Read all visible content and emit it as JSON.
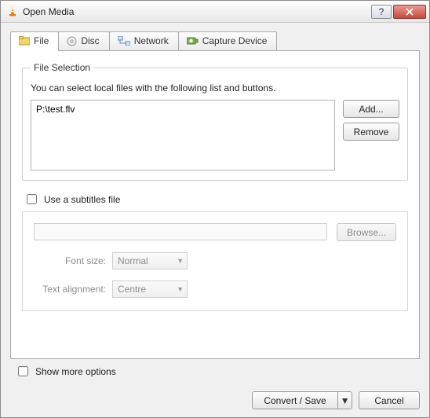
{
  "window": {
    "title": "Open Media"
  },
  "tabs": {
    "file": "File",
    "disc": "Disc",
    "network": "Network",
    "capture": "Capture Device"
  },
  "file_selection": {
    "legend": "File Selection",
    "hint": "You can select local files with the following list and buttons.",
    "files": [
      "P:\\test.flv"
    ],
    "add": "Add...",
    "remove": "Remove"
  },
  "subtitles": {
    "checkbox_label": "Use a subtitles file",
    "path": "",
    "browse": "Browse...",
    "font_size_label": "Font size:",
    "font_size_value": "Normal",
    "alignment_label": "Text alignment:",
    "alignment_value": "Centre"
  },
  "more_options_label": "Show more options",
  "buttons": {
    "primary": "Convert / Save",
    "cancel": "Cancel"
  },
  "icons": {
    "help": "?",
    "close": "×",
    "dropdown": "▼"
  }
}
